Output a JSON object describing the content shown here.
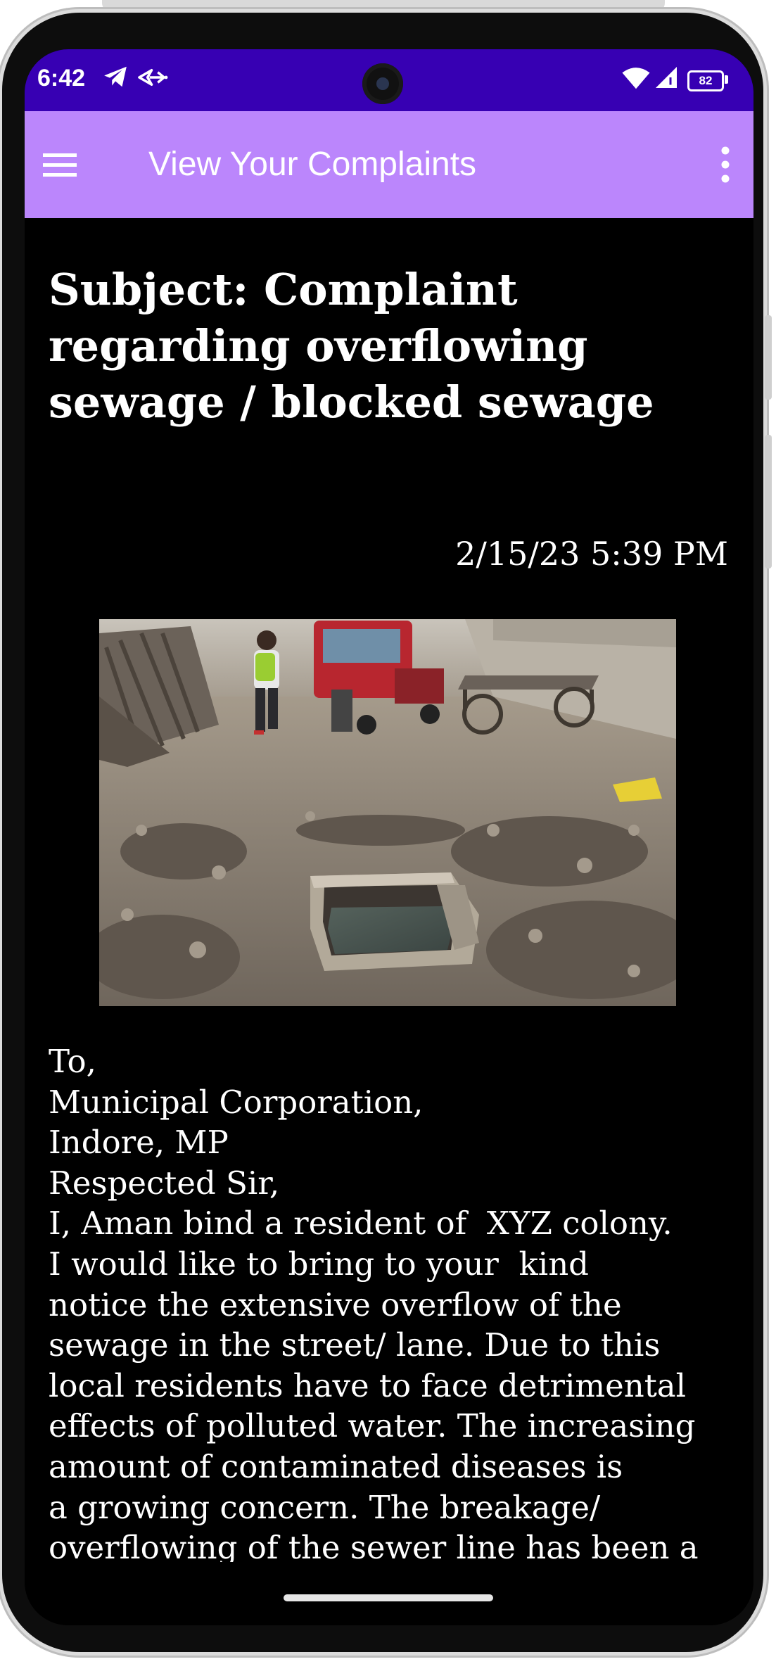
{
  "status_bar": {
    "time": "6:42",
    "battery": "82",
    "icons": [
      "telegram-icon",
      "send-arrows-icon",
      "wifi-icon",
      "signal-icon",
      "battery-icon"
    ]
  },
  "app_bar": {
    "title": "View Your Complaints",
    "menu_icon": "hamburger-menu-icon",
    "overflow_icon": "more-vert-icon"
  },
  "complaint": {
    "subject": "Subject: Complaint regarding overflowing sewage / blocked sewage",
    "date": "2/15/23 5:39 PM",
    "image": "street-sewage-photo",
    "body": "To,\nMunicipal Corporation,\nIndore, MP\nRespected Sir,\nI, Aman bind a resident of  XYZ colony.\nI would like to bring to your  kind\nnotice the extensive overflow of the\nsewage in the street/ lane. Due to this\nlocal residents have to face detrimental\neffects of polluted water. The increasing\namount of contaminated diseases is\na growing concern. The breakage/\noverflowing of the sewer line has been a"
  },
  "colors": {
    "status_bar": "#3700b3",
    "app_bar": "#bb86fc",
    "background": "#000000",
    "text": "#ffffff"
  }
}
